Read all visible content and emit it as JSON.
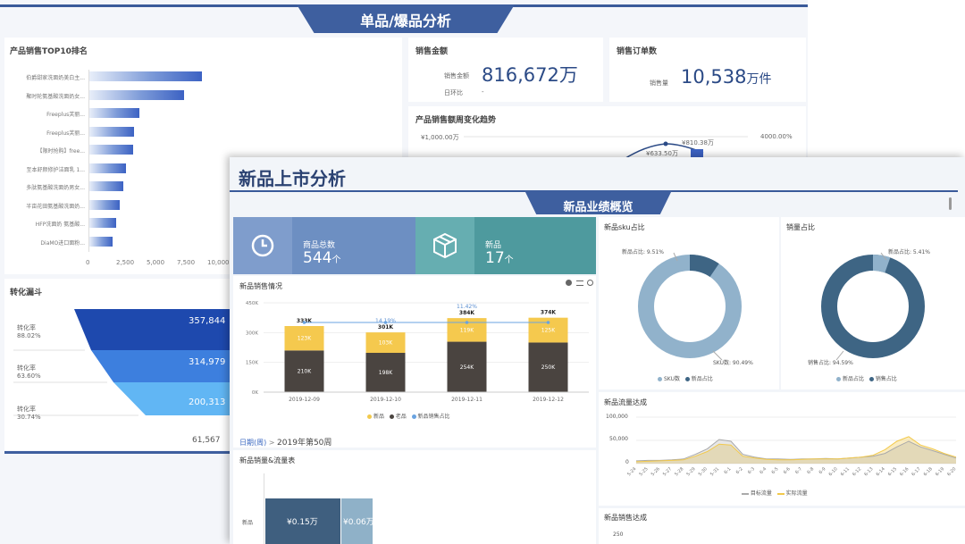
{
  "back": {
    "banner_title": "单品/爆品分析",
    "top10": {
      "title": "产品销售TOP10排名",
      "items": [
        "伯爵甜家洗面奶美白主...",
        "聚时轮氨基酸洗面奶女...",
        "Freeplus芙丽...",
        "Freeplus芙丽...",
        "【限时抢购】free...",
        "至本舒颜修护洁面乳 1...",
        "多肽氨基酸洗面奶男女...",
        "半亩花田氨基酸洗面奶...",
        "HFP洗面奶 氨基酸...",
        "DiaMO进口面粉..."
      ],
      "values": [
        9300,
        7800,
        4100,
        3700,
        3600,
        3000,
        2800,
        2500,
        2200,
        1900
      ],
      "ticks": [
        "0",
        "2,500",
        "5,000",
        "7,500",
        "10,000"
      ]
    },
    "sales_amount": {
      "title": "销售金额",
      "label": "销售金额",
      "value": "816,672",
      "unit": "万",
      "yoy_label": "日环比",
      "yoy_value": "-"
    },
    "orders": {
      "title": "销售订单数",
      "label": "销售量",
      "value": "10,538",
      "unit": "万件"
    },
    "trend": {
      "title": "产品销售额周变化趋势",
      "y_left": "¥1,000.00万",
      "y_right": "4000.00%",
      "labels": [
        "¥810.38万",
        "¥633.50万"
      ]
    },
    "funnel": {
      "title": "转化漏斗",
      "steps": [
        {
          "value": "357,844",
          "color": "#1e49ae"
        },
        {
          "value": "314,979",
          "color": "#3d7fde"
        },
        {
          "value": "200,313",
          "color": "#61b6f4"
        }
      ],
      "rates": [
        {
          "label": "转化率",
          "value": "88.02%"
        },
        {
          "label": "转化率",
          "value": "63.60%"
        },
        {
          "label": "转化率",
          "value": "30.74%"
        }
      ],
      "last": "61,567"
    }
  },
  "front": {
    "title": "新品上市分析",
    "section_title": "新品业绩概览",
    "kpi1": {
      "label": "商品总数",
      "value": "544",
      "unit": "个"
    },
    "kpi2": {
      "label": "新品",
      "value": "17",
      "unit": "个"
    },
    "sales": {
      "title": "新品销售情况",
      "y_ticks": [
        "450K",
        "300K",
        "150K",
        "0K"
      ],
      "chart_data": {
        "type": "bar",
        "categories": [
          "2019-12-09",
          "2019-12-10",
          "2019-12-11",
          "2019-12-12"
        ],
        "series": [
          {
            "name": "新品",
            "values": [
              123,
              103,
              119,
              125
            ]
          },
          {
            "name": "老品",
            "values": [
              210,
              198,
              254,
              250
            ]
          }
        ],
        "totals": [
          "333K",
          "301K",
          "384K",
          "374K"
        ],
        "ratio": {
          "name": "新品销售占比",
          "values": [
            "",
            "14.19%",
            "11.42%",
            ""
          ]
        },
        "ylim": [
          0,
          450
        ]
      },
      "seg_new": [
        "123K",
        "103K",
        "119K",
        "125K"
      ],
      "seg_old": [
        "210K",
        "198K",
        "254K",
        "250K"
      ],
      "breadcrumb_root": "日期(周)",
      "breadcrumb_sep": ">",
      "breadcrumb_leaf": "2019年第50周"
    },
    "sku": {
      "title": "新品sku占比",
      "new_label": "新品占比: 9.51%",
      "sku_label": "SKU数: 90.49%",
      "legend": [
        "SKU数",
        "新品占比"
      ],
      "chart_data": {
        "type": "pie",
        "values": [
          90.49,
          9.51
        ]
      }
    },
    "share": {
      "title": "销量占比",
      "new_label": "新品占比: 5.41%",
      "sale_label": "销售占比: 94.59%",
      "legend": [
        "新品占比",
        "销售占比"
      ],
      "chart_data": {
        "type": "pie",
        "values": [
          5.41,
          94.59
        ]
      }
    },
    "flow": {
      "title": "新品流量达成",
      "y_ticks": [
        "100,000",
        "50,000",
        "0"
      ],
      "x_ticks": [
        "5-24",
        "5-25",
        "5-26",
        "5-27",
        "5-28",
        "5-29",
        "5-30",
        "5-31",
        "6-1",
        "6-2",
        "6-3",
        "6-4",
        "6-5",
        "6-6",
        "6-7",
        "6-8",
        "6-9",
        "6-10",
        "6-11",
        "6-12",
        "6-13",
        "6-14",
        "6-15",
        "6-16",
        "6-17",
        "6-18",
        "6-19",
        "6-20"
      ],
      "legend": [
        "目标流量",
        "实际流量"
      ]
    },
    "table": {
      "title": "新品销量&流量表",
      "row": "新品",
      "v1": "¥0.15万",
      "v2": "¥0.06万"
    },
    "sales_reach": {
      "title": "新品销售达成",
      "y_top": "250"
    }
  }
}
